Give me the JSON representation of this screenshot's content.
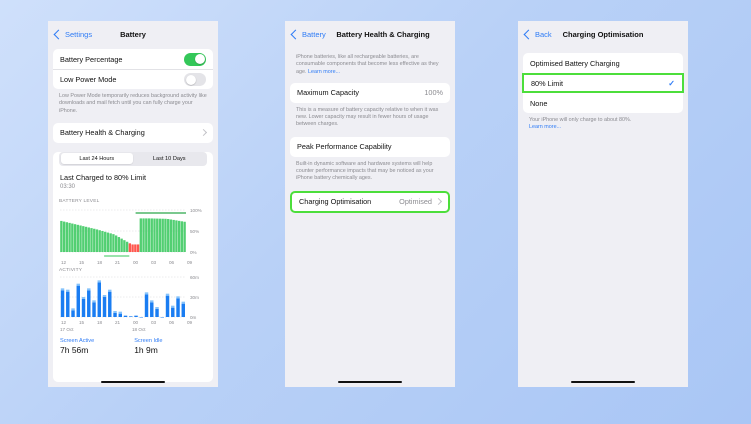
{
  "screen1": {
    "nav": {
      "back": "Settings",
      "title": "Battery"
    },
    "battery_percentage_label": "Battery Percentage",
    "battery_percentage_on": true,
    "low_power_label": "Low Power Mode",
    "low_power_on": false,
    "low_power_footer": "Low Power Mode temporarily reduces background activity like downloads and mail fetch until you can fully charge your iPhone.",
    "health_row": "Battery Health & Charging",
    "segments": [
      "Last 24 Hours",
      "Last 10 Days"
    ],
    "last_charged": "Last Charged to 80% Limit",
    "last_charged_time": "03:30",
    "battery_level_label": "BATTERY LEVEL",
    "battery_y_ticks": [
      "100%",
      "50%",
      "0%"
    ],
    "activity_label": "ACTIVITY",
    "activity_y_ticks": [
      "60m",
      "30m",
      "0m"
    ],
    "x_ticks": [
      "12",
      "15",
      "18",
      "21",
      "00",
      "03",
      "06",
      "09"
    ],
    "date_labels": [
      "17 Oct",
      "18 Oct"
    ],
    "screen_active_label": "Screen Active",
    "screen_active_value": "7h 56m",
    "screen_idle_label": "Screen Idle",
    "screen_idle_value": "1h 9m",
    "colors": {
      "green": "#34c759",
      "red": "#ff3b30",
      "blue": "#1a7df2"
    },
    "chart_data": [
      {
        "type": "area",
        "title": "BATTERY LEVEL",
        "ylim": [
          0,
          100
        ],
        "x": [
          "12",
          "15",
          "18",
          "21",
          "00",
          "03",
          "06",
          "09"
        ],
        "series": [
          {
            "values": [
              74,
              64,
              54,
              42,
              18,
              80,
              79,
              72
            ]
          }
        ]
      },
      {
        "type": "bar",
        "title": "ACTIVITY",
        "ylim": [
          0,
          60
        ],
        "values": [
          40,
          38,
          10,
          47,
          27,
          40,
          22,
          52,
          30,
          38,
          6,
          5,
          2,
          1,
          2,
          0,
          34,
          22,
          12,
          0,
          32,
          14,
          28,
          20
        ]
      }
    ]
  },
  "screen2": {
    "nav": {
      "back": "Battery",
      "title": "Battery Health & Charging"
    },
    "intro": "iPhone batteries, like all rechargeable batteries, are consumable components that become less effective as they age.",
    "intro_link": "Learn more...",
    "max_capacity_label": "Maximum Capacity",
    "max_capacity_value": "100%",
    "max_capacity_footer": "This is a measure of battery capacity relative to when it was new. Lower capacity may result in fewer hours of usage between charges.",
    "peak_label": "Peak Performance Capability",
    "peak_footer": "Built-in dynamic software and hardware systems will help counter performance impacts that may be noticed as your iPhone battery chemically ages.",
    "charging_opt_label": "Charging Optimisation",
    "charging_opt_value": "Optimised"
  },
  "screen3": {
    "nav": {
      "back": "Back",
      "title": "Charging Optimisation"
    },
    "options": [
      "Optimised Battery Charging",
      "80% Limit",
      "None"
    ],
    "selected_option": "80% Limit",
    "footer": "Your iPhone will only charge to about 80%.",
    "footer_link": "Learn more..."
  }
}
